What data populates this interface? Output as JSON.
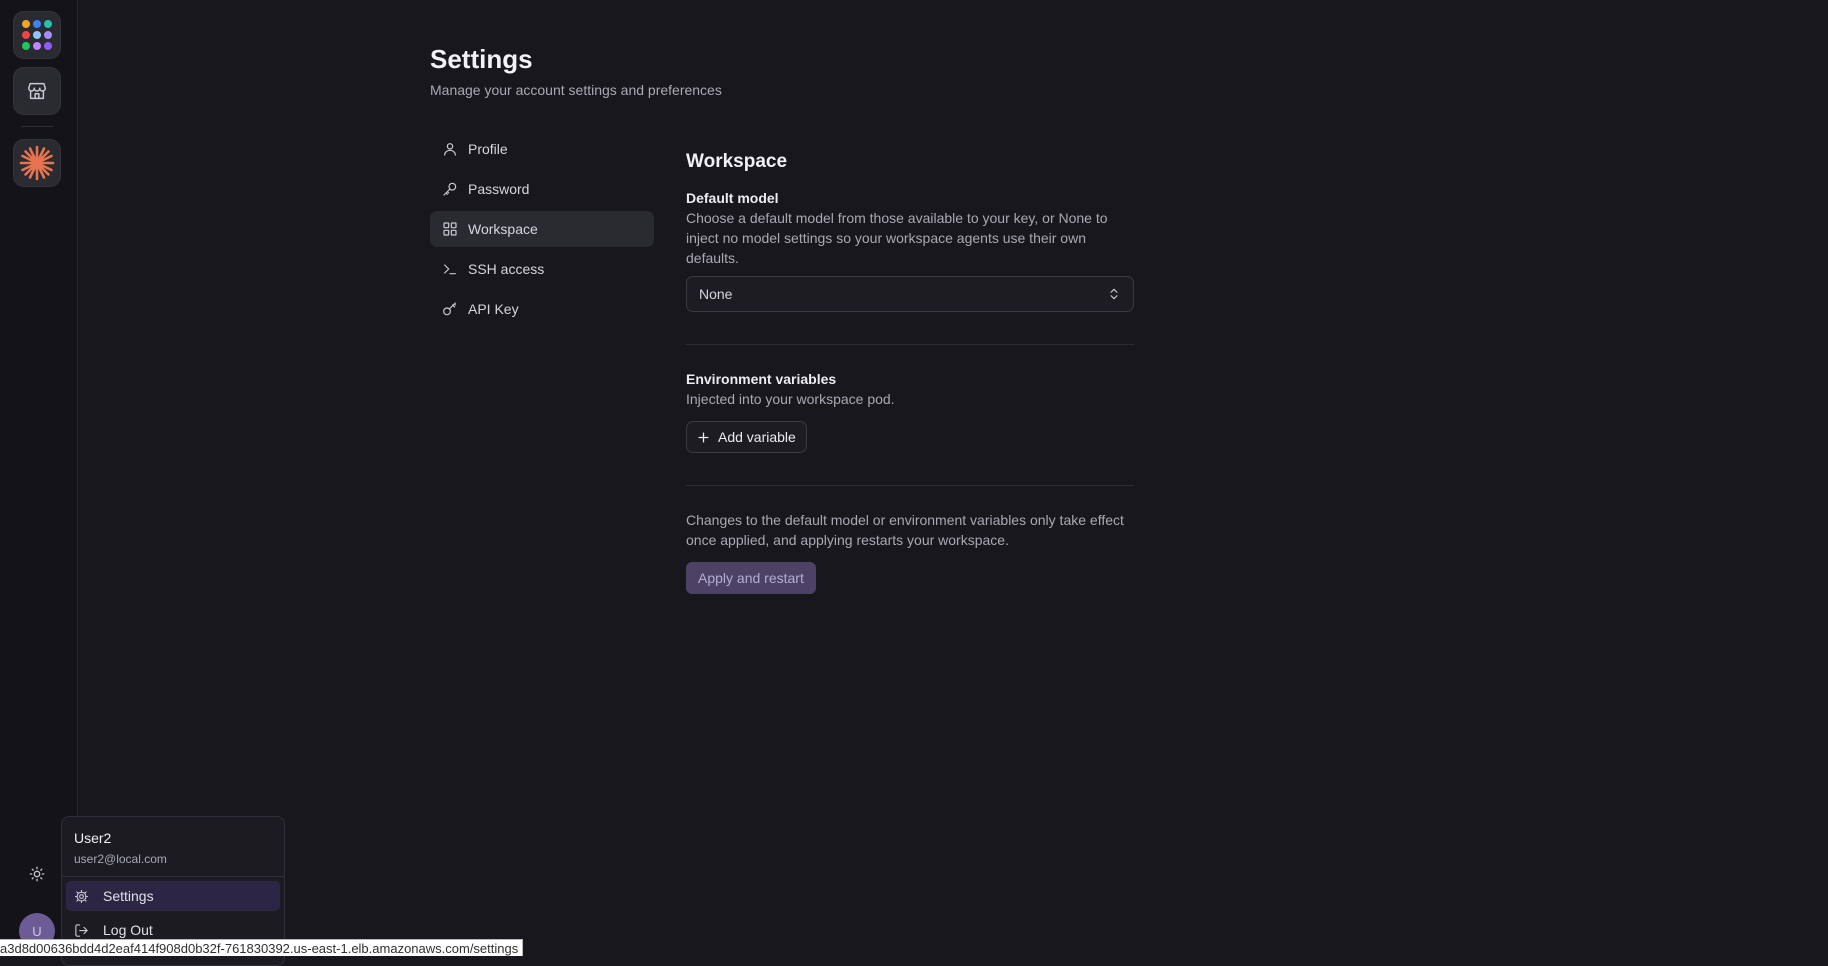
{
  "rail": {
    "apps_icon": "apps-grid-icon",
    "store_icon": "store-icon",
    "agent_icon": "sparkle-burst-icon",
    "theme_icon": "sun-icon",
    "avatar_initial": "U",
    "dot_colors": [
      "#f5a524",
      "#3b82f6",
      "#22c3a6",
      "#ef4444",
      "#93c5fd",
      "#a78bfa",
      "#22c55e",
      "#c084fc",
      "#8b5cf6"
    ],
    "accent_color": "#e8734f"
  },
  "header": {
    "title": "Settings",
    "subtitle": "Manage your account settings and preferences"
  },
  "nav": {
    "items": [
      {
        "label": "Profile",
        "icon": "user-icon",
        "active": false
      },
      {
        "label": "Password",
        "icon": "key-icon",
        "active": false
      },
      {
        "label": "Workspace",
        "icon": "grid-icon",
        "active": true
      },
      {
        "label": "SSH access",
        "icon": "terminal-icon",
        "active": false
      },
      {
        "label": "API Key",
        "icon": "key-round-icon",
        "active": false
      }
    ]
  },
  "workspace": {
    "title": "Workspace",
    "default_model": {
      "label": "Default model",
      "description": "Choose a default model from those available to your key, or None to inject no model settings so your workspace agents use their own defaults.",
      "value": "None"
    },
    "env_vars": {
      "label": "Environment variables",
      "description": "Injected into your workspace pod.",
      "add_label": "Add variable"
    },
    "apply_note": "Changes to the default model or environment variables only take effect once applied, and applying restarts your workspace.",
    "apply_label": "Apply and restart"
  },
  "user_menu": {
    "name": "User2",
    "email": "user2@local.com",
    "items": [
      {
        "label": "Settings",
        "icon": "gear-icon"
      },
      {
        "label": "Log Out",
        "icon": "logout-icon"
      }
    ]
  },
  "status_url": "a3d8d00636bdd4d2eaf414f908d0b32f-761830392.us-east-1.elb.amazonaws.com/settings"
}
